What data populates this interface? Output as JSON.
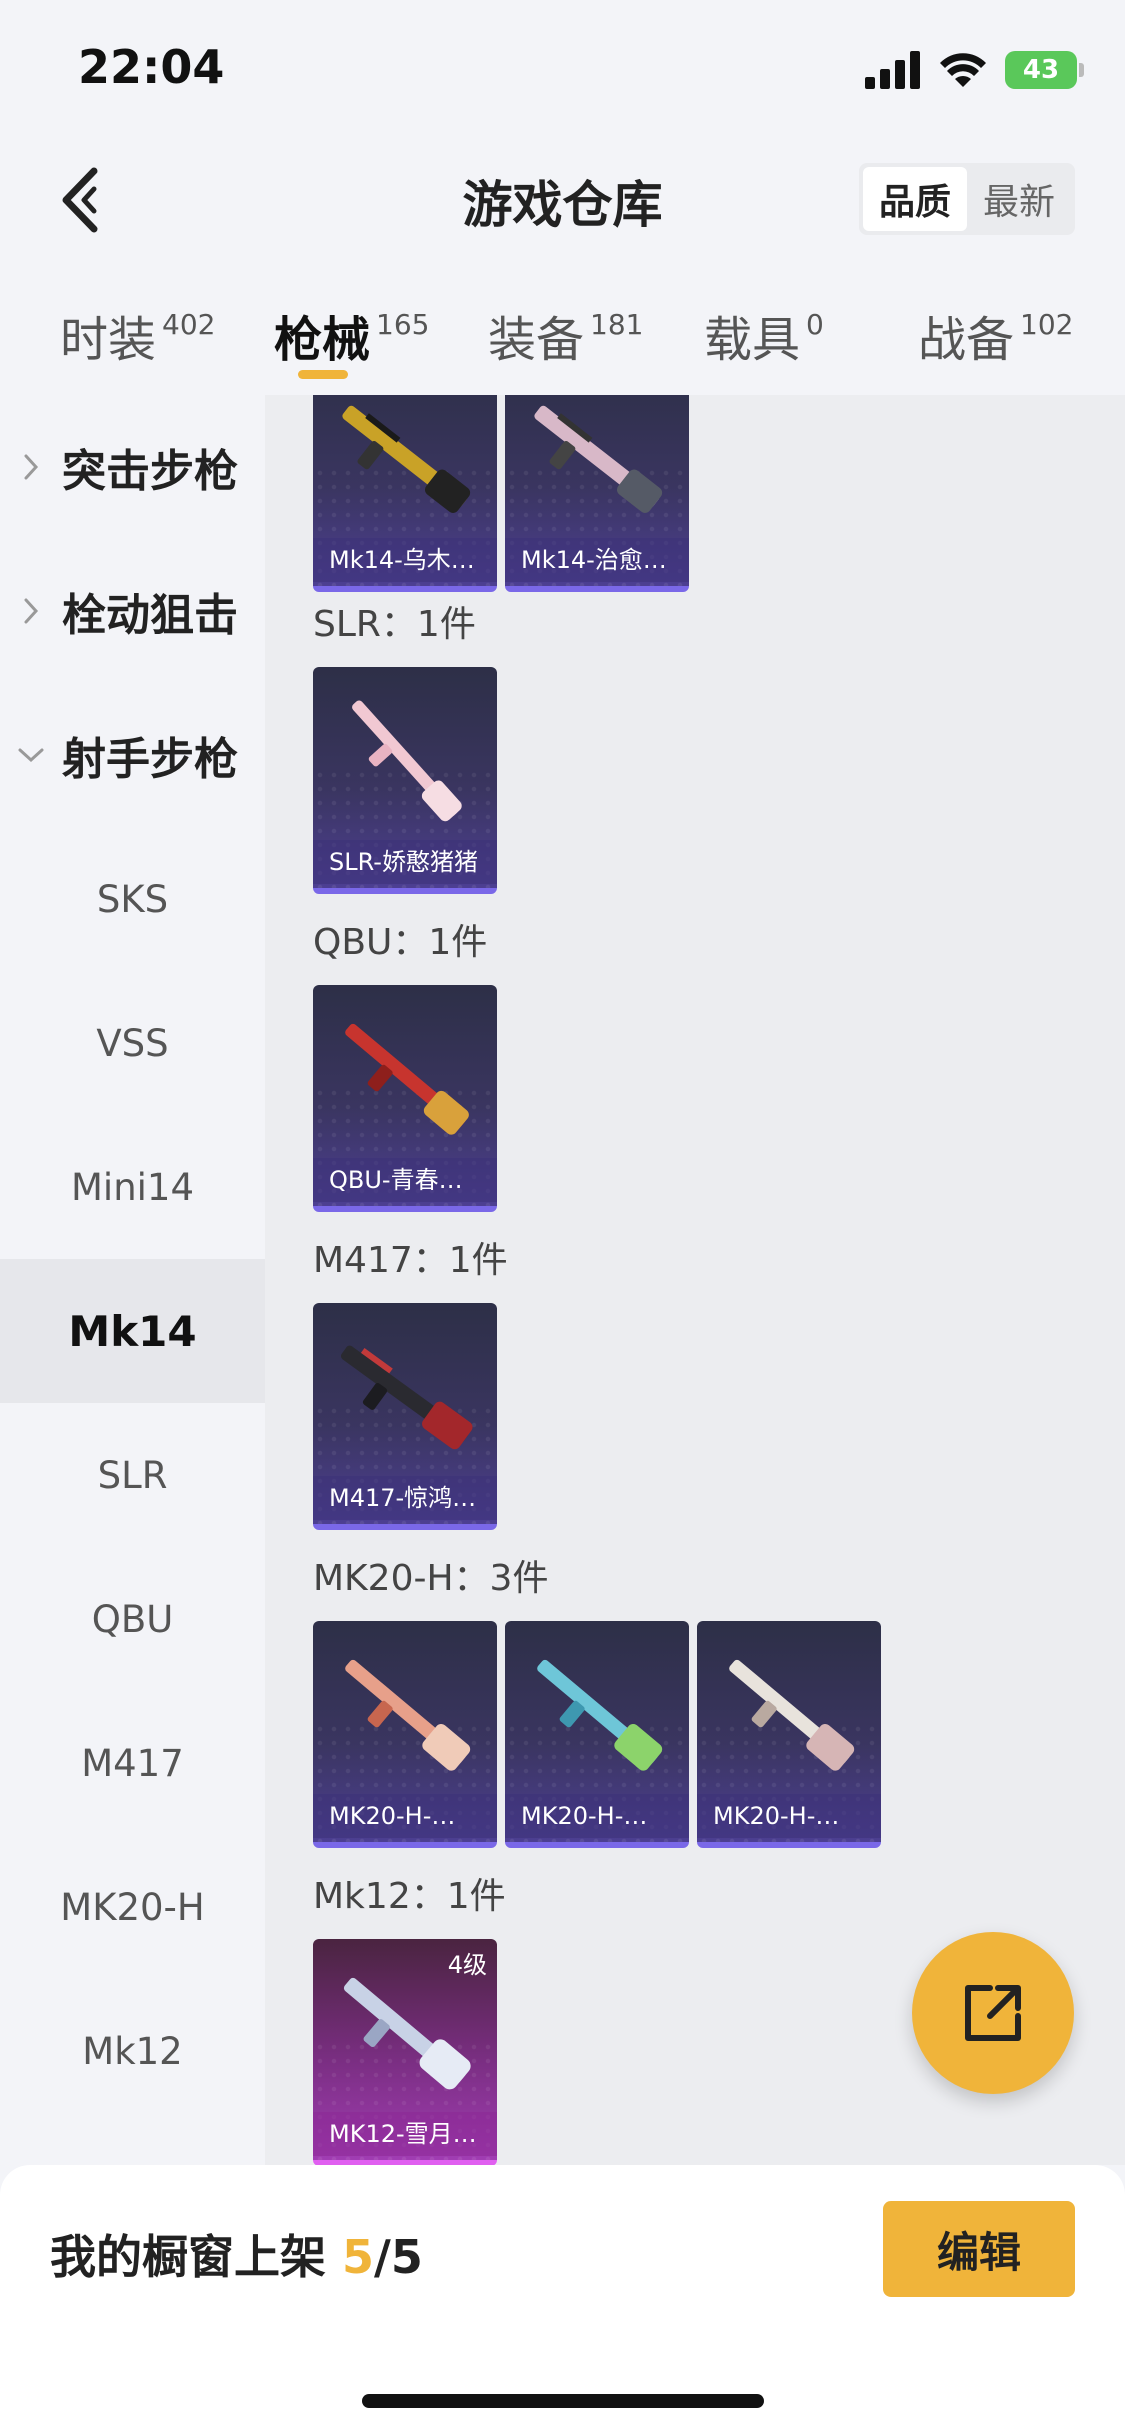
{
  "status": {
    "time": "22:04",
    "battery": "43"
  },
  "header": {
    "title": "游戏仓库",
    "sort_options": [
      "品质",
      "最新"
    ],
    "active_sort": 0
  },
  "tabs": [
    {
      "label": "时装",
      "count": "402"
    },
    {
      "label": "枪械",
      "count": "165"
    },
    {
      "label": "装备",
      "count": "181"
    },
    {
      "label": "载具",
      "count": "0"
    },
    {
      "label": "战备",
      "count": "102"
    }
  ],
  "active_tab": 1,
  "sidebar": {
    "groups": [
      {
        "label": "突击步枪",
        "expanded": false
      },
      {
        "label": "栓动狙击",
        "expanded": false
      },
      {
        "label": "射手步枪",
        "expanded": true
      }
    ],
    "items": [
      "SKS",
      "VSS",
      "Mini14",
      "Mk14",
      "SLR",
      "QBU",
      "M417",
      "MK20-H",
      "Mk12"
    ],
    "active_item": "Mk14"
  },
  "sections": [
    {
      "label": "",
      "items": [
        {
          "name": "Mk14-乌木…"
        },
        {
          "name": "Mk14-治愈…"
        }
      ]
    },
    {
      "label": "SLR：1件",
      "items": [
        {
          "name": "SLR-娇憨猪猪"
        }
      ]
    },
    {
      "label": "QBU：1件",
      "items": [
        {
          "name": "QBU-青春…"
        }
      ]
    },
    {
      "label": "M417：1件",
      "items": [
        {
          "name": "M417-惊鸿…"
        }
      ]
    },
    {
      "label": "MK20-H：3件",
      "items": [
        {
          "name": "MK20-H-…"
        },
        {
          "name": "MK20-H-…"
        },
        {
          "name": "MK20-H-…"
        }
      ]
    },
    {
      "label": "Mk12：1件",
      "items": [
        {
          "name": "MK12-雪月…",
          "level": "4级",
          "rarity": "purple"
        }
      ]
    }
  ],
  "bottom": {
    "shelf_label": "我的橱窗上架",
    "shelf_count": "5",
    "shelf_total": "/5",
    "edit_label": "编辑"
  },
  "colors": {
    "accent": "#f0b43a",
    "card_blue_border": "#7a68e8",
    "card_purple_border": "#e060f0"
  },
  "icons": {
    "back": "back-icon",
    "share": "share-icon",
    "signal": "signal-icon",
    "wifi": "wifi-icon",
    "battery": "battery-icon"
  }
}
